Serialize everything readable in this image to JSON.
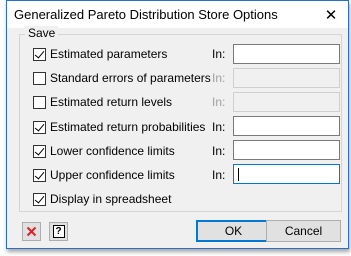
{
  "window": {
    "title": "Generalized Pareto Distribution Store Options",
    "close_glyph": "✕"
  },
  "save_group": {
    "label": "Save",
    "options": [
      {
        "label": "Estimated parameters",
        "checked": true,
        "in_label": "In:",
        "enabled": true,
        "value": ""
      },
      {
        "label": "Standard errors of parameters",
        "checked": false,
        "in_label": "In:",
        "enabled": false,
        "value": ""
      },
      {
        "label": "Estimated return levels",
        "checked": false,
        "in_label": "In:",
        "enabled": false,
        "value": ""
      },
      {
        "label": "Estimated return probabilities",
        "checked": true,
        "in_label": "In:",
        "enabled": true,
        "value": ""
      },
      {
        "label": "Lower confidence limits",
        "checked": true,
        "in_label": "In:",
        "enabled": true,
        "value": ""
      },
      {
        "label": "Upper confidence limits",
        "checked": true,
        "in_label": "In:",
        "enabled": true,
        "value": ""
      }
    ],
    "spreadsheet": {
      "label": "Display in spreadsheet",
      "checked": true
    }
  },
  "footer": {
    "clear_icon": "red-x-icon",
    "help_icon": "question-mark-icon",
    "help_glyph": "?",
    "ok_label": "OK",
    "cancel_label": "Cancel"
  },
  "colors": {
    "accent": "#0078d7",
    "clear_icon": "#d8262b"
  }
}
